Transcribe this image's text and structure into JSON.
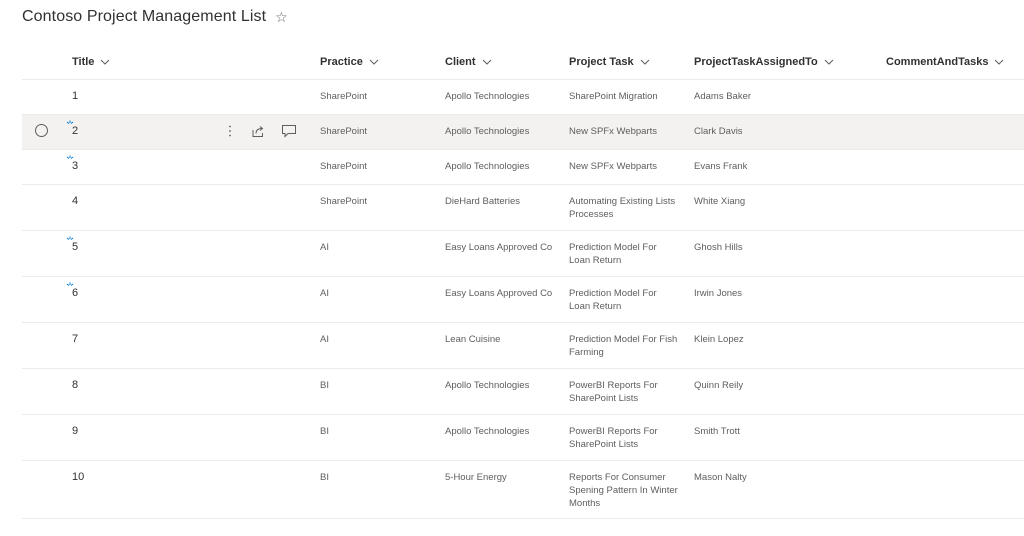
{
  "list": {
    "title": "Contoso Project Management List",
    "favorite_icon": "star-outline-icon"
  },
  "columns": [
    {
      "key": "title",
      "label": "Title"
    },
    {
      "key": "practice",
      "label": "Practice"
    },
    {
      "key": "client",
      "label": "Client"
    },
    {
      "key": "task",
      "label": "Project Task"
    },
    {
      "key": "assigned",
      "label": "ProjectTaskAssignedTo"
    },
    {
      "key": "comment",
      "label": "CommentAndTasks"
    }
  ],
  "rows": [
    {
      "title": "1",
      "practice": "SharePoint",
      "client": "Apollo Technologies",
      "task": "SharePoint Migration",
      "assigned": "Adams Baker",
      "comment": "",
      "is_new": false,
      "selected": false,
      "size": "normal"
    },
    {
      "title": "2",
      "practice": "SharePoint",
      "client": "Apollo Technologies",
      "task": "New SPFx Webparts",
      "assigned": "Clark Davis",
      "comment": "",
      "is_new": true,
      "selected": true,
      "size": "normal"
    },
    {
      "title": "3",
      "practice": "SharePoint",
      "client": "Apollo Technologies",
      "task": "New SPFx Webparts",
      "assigned": "Evans Frank",
      "comment": "",
      "is_new": true,
      "selected": false,
      "size": "normal"
    },
    {
      "title": "4",
      "practice": "SharePoint",
      "client": "DieHard Batteries",
      "task": "Automating Existing Lists Processes",
      "assigned": "White Xiang",
      "comment": "",
      "is_new": false,
      "selected": false,
      "size": "tall"
    },
    {
      "title": "5",
      "practice": "AI",
      "client": "Easy Loans Approved Co",
      "task": "Prediction Model For Loan Return",
      "assigned": "Ghosh Hills",
      "comment": "",
      "is_new": true,
      "selected": false,
      "size": "tall"
    },
    {
      "title": "6",
      "practice": "AI",
      "client": "Easy Loans Approved Co",
      "task": "Prediction Model For Loan Return",
      "assigned": "Irwin Jones",
      "comment": "",
      "is_new": true,
      "selected": false,
      "size": "tall"
    },
    {
      "title": "7",
      "practice": "AI",
      "client": "Lean Cuisine",
      "task": "Prediction Model For Fish Farming",
      "assigned": "Klein Lopez",
      "comment": "",
      "is_new": false,
      "selected": false,
      "size": "tall"
    },
    {
      "title": "8",
      "practice": "BI",
      "client": "Apollo Technologies",
      "task": "PowerBI Reports For SharePoint Lists",
      "assigned": "Quinn Reily",
      "comment": "",
      "is_new": false,
      "selected": false,
      "size": "tall"
    },
    {
      "title": "9",
      "practice": "BI",
      "client": "Apollo Technologies",
      "task": "PowerBI Reports For SharePoint Lists",
      "assigned": "Smith Trott",
      "comment": "",
      "is_new": false,
      "selected": false,
      "size": "tall"
    },
    {
      "title": "10",
      "practice": "BI",
      "client": "5-Hour Energy",
      "task": "Reports For Consumer Spening Pattern In Winter Months",
      "assigned": "Mason Nalty",
      "comment": "",
      "is_new": false,
      "selected": false,
      "size": "tallest"
    }
  ],
  "row_actions": {
    "more_icon": "more-vertical-icon",
    "share_icon": "share-icon",
    "comment_icon": "comment-icon"
  },
  "colors": {
    "text_primary": "#323130",
    "text_secondary": "#605e5c",
    "divider": "#edebe9",
    "selected_row": "#f3f2f1",
    "new_indicator": "#0078d4"
  }
}
